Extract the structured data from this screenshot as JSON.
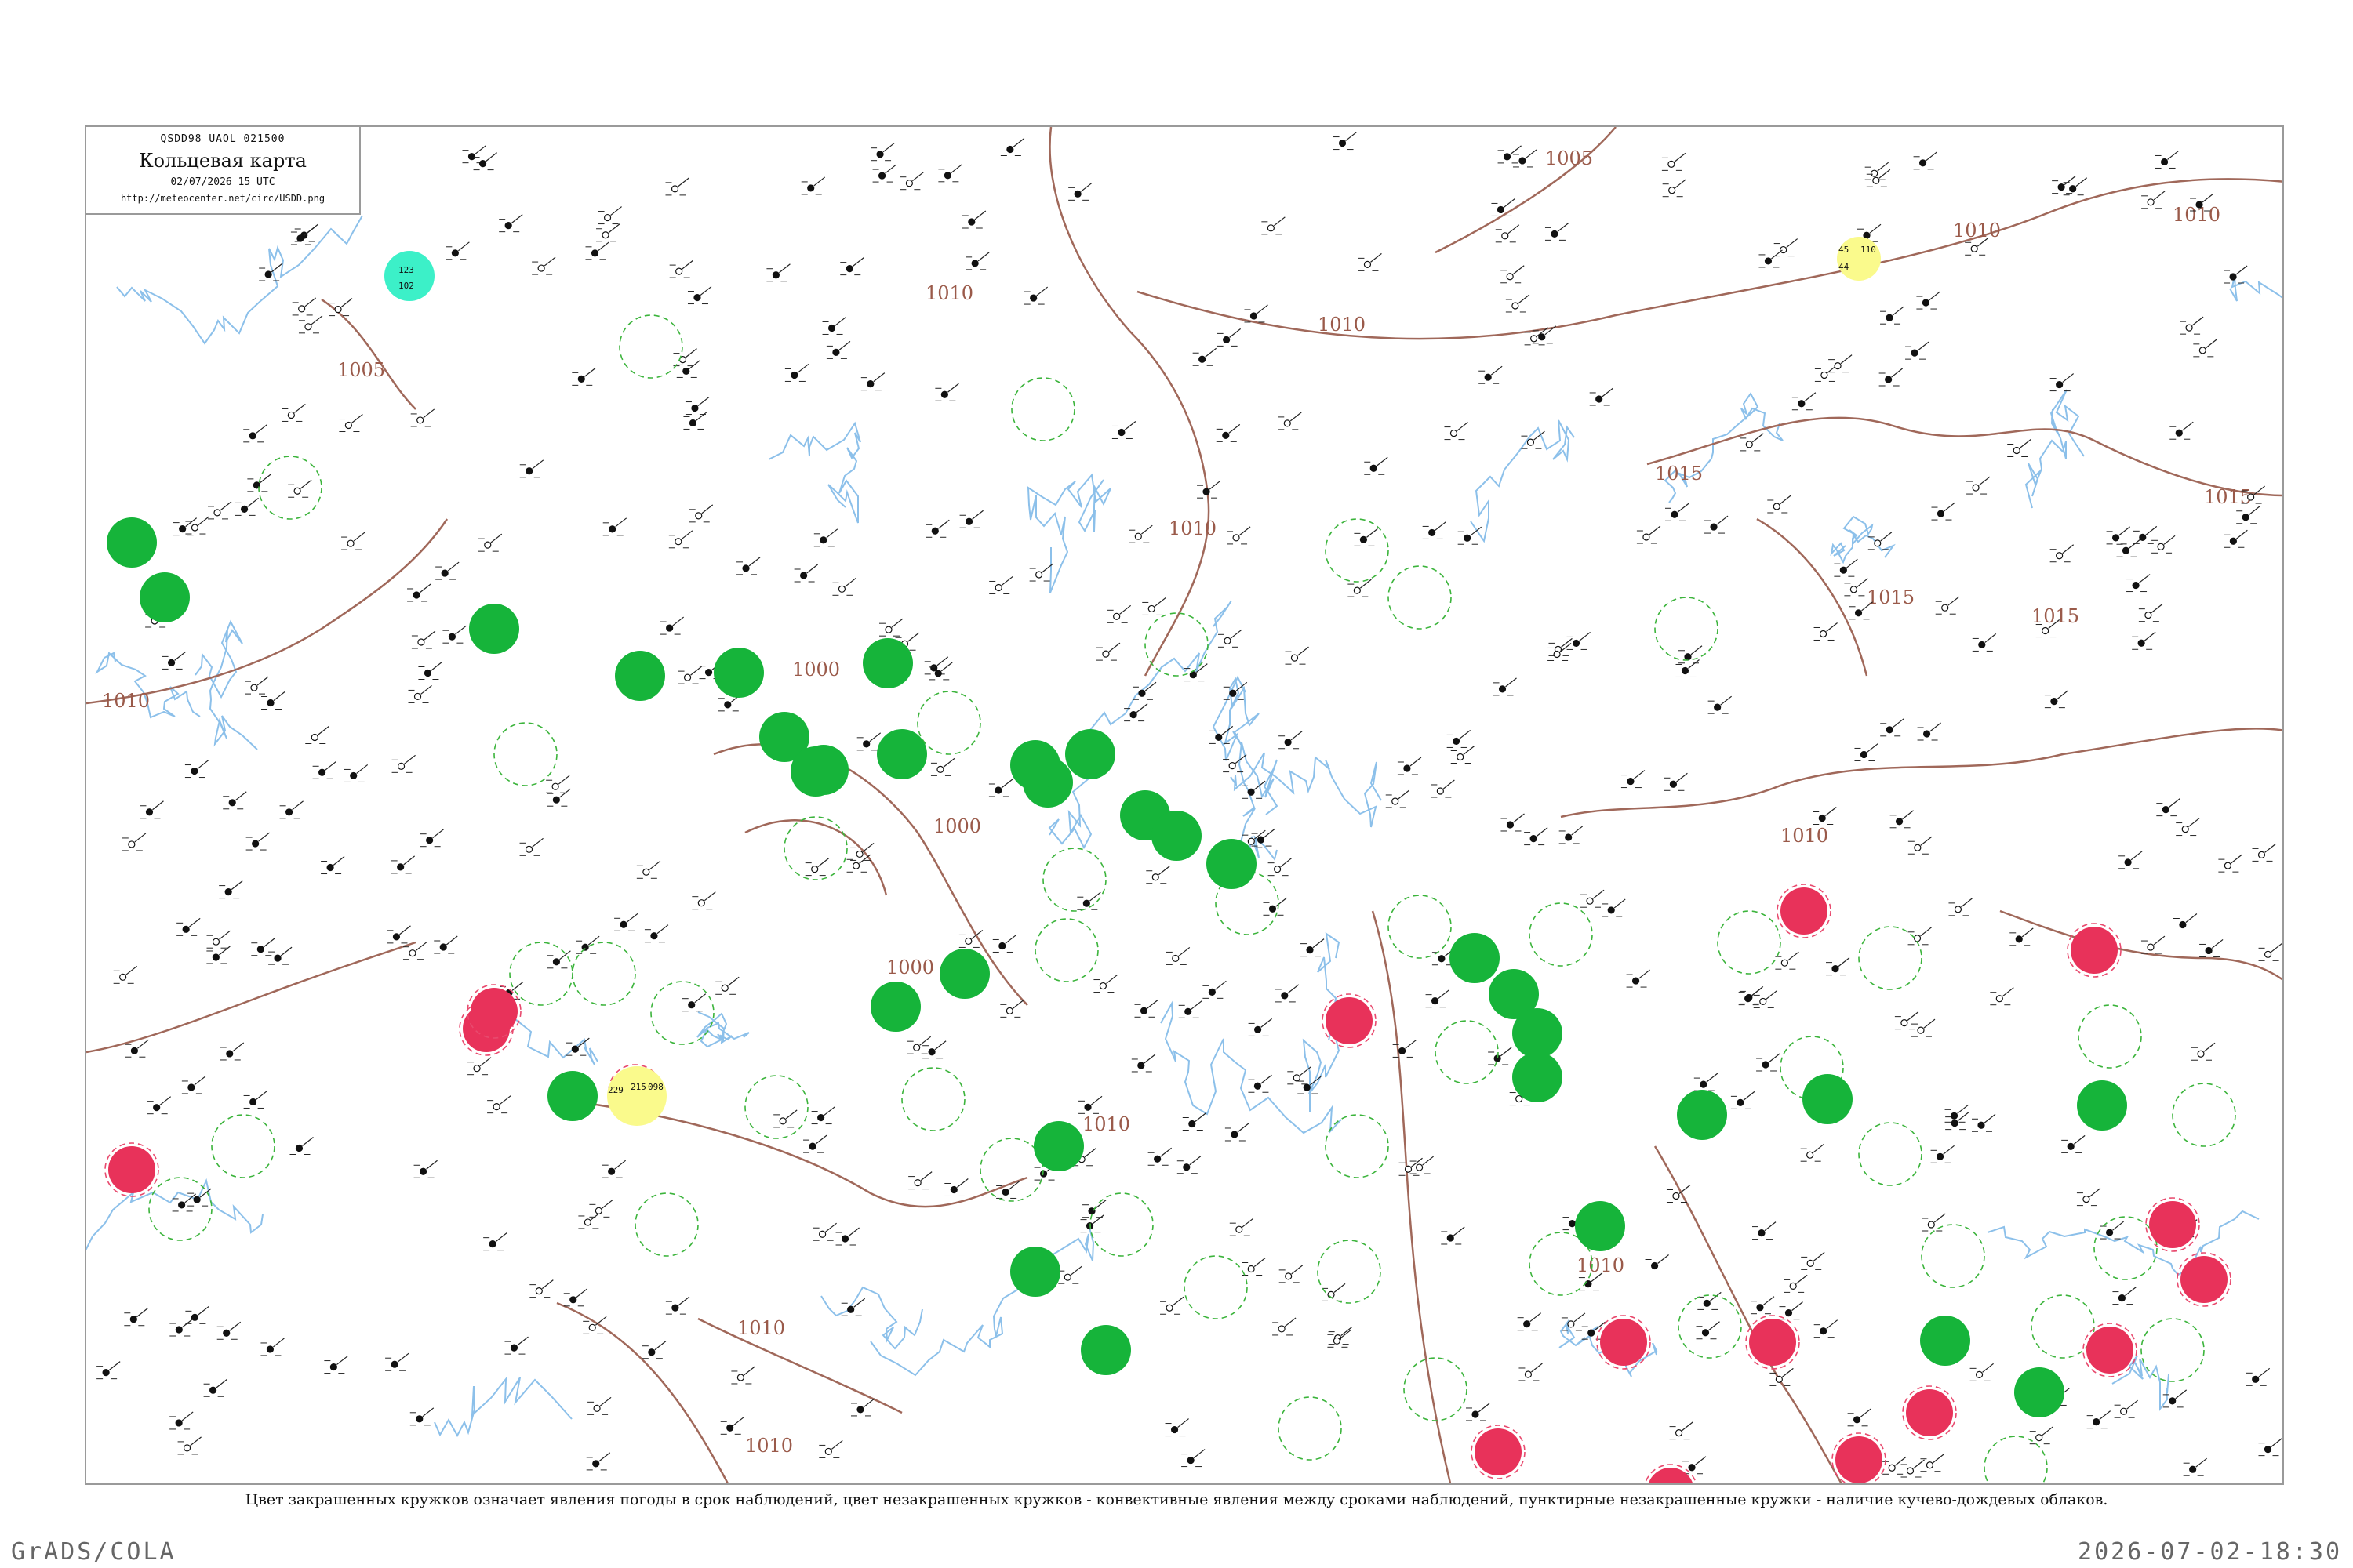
{
  "header": {
    "code": "QSDD98  UAOL  021500",
    "title": "Кольцевая карта",
    "date": "02/07/2026 15 UTC",
    "url": "http://meteocenter.net/circ/USDD.png"
  },
  "caption": "Цвет закрашенных кружков означает явления погоды в срок наблюдений, цвет незакрашенных кружков - конвективные явления между сроками наблюдений, пунктирные незакрашенные кружки - наличие кучево-дождевых облаков.",
  "footer": {
    "left": "GrADS/COLA",
    "right": "2026-07-02-18:30"
  },
  "colors": {
    "green": "#16b43a",
    "red": "#e8325a",
    "yellow": "#fafa8c",
    "cyan": "#3cf0c8",
    "isobar": "#a0685a",
    "river": "#8cc0ea",
    "dashed_green": "#3cb43c",
    "ring_red": "#e84a6e",
    "frame": "#9a9a9a"
  },
  "isobar_labels": [
    "1005",
    "1005",
    "1010",
    "1010",
    "1010",
    "1010",
    "1010",
    "1010",
    "1010",
    "1010",
    "1015",
    "1015",
    "1015",
    "1015",
    "1000",
    "1000",
    "1000",
    "1010",
    "1010",
    "1010"
  ],
  "highlight_stations": [
    {
      "top": "123",
      "mid": "",
      "bottom": "102"
    },
    {
      "top": "45",
      "mid": "110",
      "bottom": "44"
    },
    {
      "top": "229",
      "mid": "215",
      "bottom": "098"
    }
  ]
}
